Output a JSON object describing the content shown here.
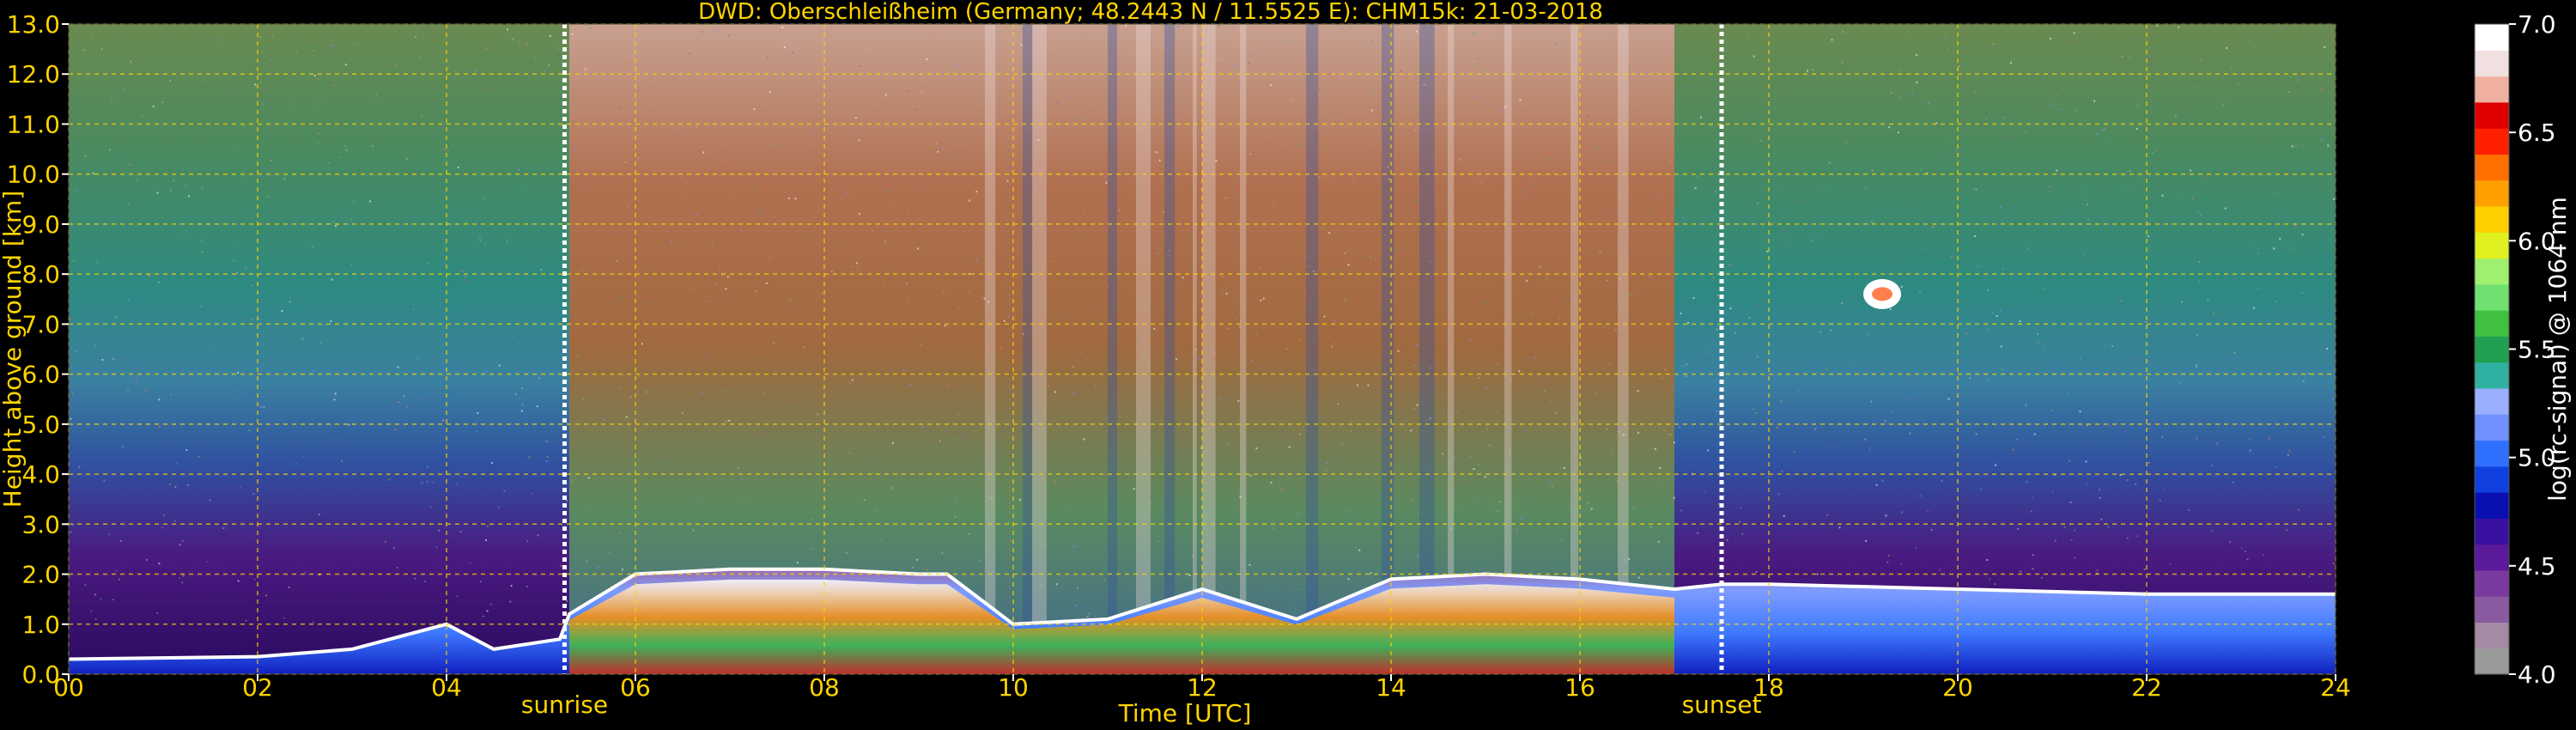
{
  "chart_data": {
    "type": "heatmap",
    "title": "DWD: Oberschleißheim (Germany; 48.2443 N / 11.5525 E):    CHM15k: 21-03-2018",
    "xlabel": "Time [UTC]",
    "ylabel": "Height above ground [km]",
    "xlim": [
      0,
      24
    ],
    "ylim": [
      0,
      13
    ],
    "x_ticks": [
      "00",
      "02",
      "04",
      "06",
      "08",
      "10",
      "12",
      "14",
      "16",
      "18",
      "20",
      "22",
      "24"
    ],
    "x_tick_values": [
      0,
      2,
      4,
      6,
      8,
      10,
      12,
      14,
      16,
      18,
      20,
      22,
      24
    ],
    "y_ticks": [
      "0.0",
      "1.0",
      "2.0",
      "3.0",
      "4.0",
      "5.0",
      "6.0",
      "7.0",
      "8.0",
      "9.0",
      "10.0",
      "11.0",
      "12.0",
      "13.0"
    ],
    "y_tick_values": [
      0,
      1,
      2,
      3,
      4,
      5,
      6,
      7,
      8,
      9,
      10,
      11,
      12,
      13
    ],
    "grid": true,
    "markers": [
      {
        "label": "sunrise",
        "time": 5.25
      },
      {
        "label": "sunset",
        "time": 17.5
      }
    ],
    "colorbar": {
      "label": "log(rc-signal) @ 1064 nm",
      "range": [
        4.0,
        7.0
      ],
      "ticks": [
        "4.0",
        "4.5",
        "5.0",
        "5.5",
        "6.0",
        "6.5",
        "7.0"
      ],
      "tick_values": [
        4.0,
        4.5,
        5.0,
        5.5,
        6.0,
        6.5,
        7.0
      ],
      "colors": [
        "#9a9a9a",
        "#a58aa5",
        "#8a5aa0",
        "#7a3aa0",
        "#5a1a9a",
        "#3a10a0",
        "#0a10b0",
        "#1040e0",
        "#3070ff",
        "#7090ff",
        "#9ab0ff",
        "#30b0a0",
        "#20a050",
        "#40c040",
        "#70e070",
        "#a0f070",
        "#e0f020",
        "#ffd000",
        "#ffa000",
        "#ff7000",
        "#ff2000",
        "#e00000",
        "#f0b0a0",
        "#f0e0e0",
        "#ffffff"
      ]
    },
    "layers": [
      {
        "name": "boundary_layer_top_km",
        "time": [
          0,
          2,
          3,
          4,
          4.5,
          5.2,
          5.3,
          6,
          7,
          8,
          9,
          9.3,
          10,
          11,
          12,
          13,
          14,
          15,
          16,
          17,
          17.5,
          18,
          20,
          22,
          24
        ],
        "height": [
          0.3,
          0.35,
          0.5,
          1.0,
          0.5,
          0.7,
          1.2,
          2.0,
          2.1,
          2.1,
          2.0,
          2.0,
          1.0,
          1.1,
          1.7,
          1.1,
          1.9,
          2.0,
          1.9,
          1.7,
          1.8,
          1.8,
          1.7,
          1.6,
          1.6
        ]
      },
      {
        "name": "cloud_patch_km",
        "time": [
          19.0,
          19.4
        ],
        "height": [
          7.3,
          7.9
        ]
      }
    ]
  }
}
